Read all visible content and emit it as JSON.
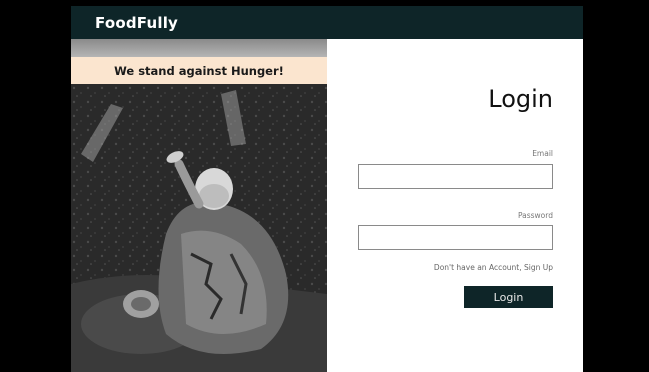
{
  "navbar": {
    "brand": "FoodFully"
  },
  "hero": {
    "banner_text": "We stand against Hunger!"
  },
  "login": {
    "title": "Login",
    "email_label": "Email",
    "email_value": "",
    "password_label": "Password",
    "password_value": "",
    "signup_text": "Don't have an Account, Sign Up",
    "button_label": "Login"
  },
  "colors": {
    "navbar_bg": "#0e2528",
    "banner_bg": "#fbe5cf",
    "button_bg": "#0e2528",
    "page_bg": "#000000"
  }
}
